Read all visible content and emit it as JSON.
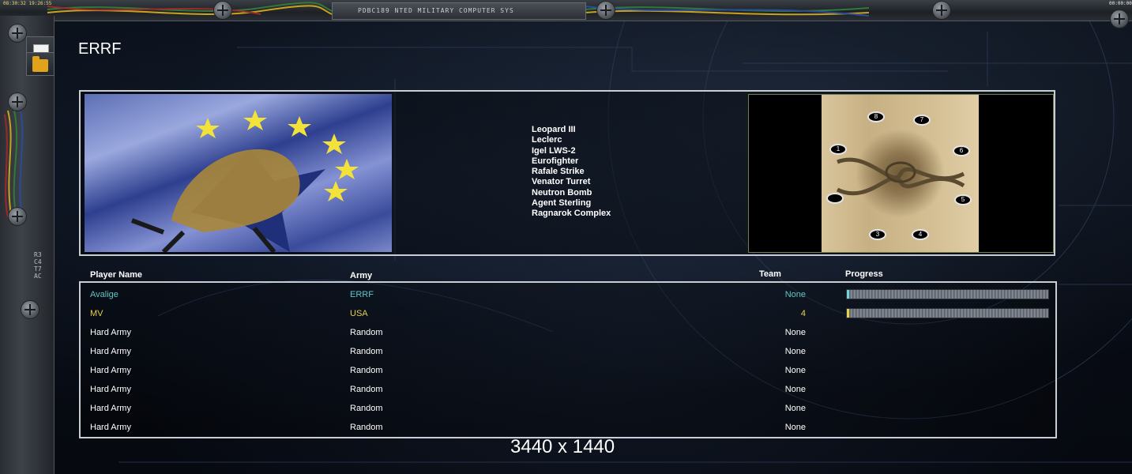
{
  "window": {
    "top_title": "PDBC189 NTED MILITARY COMPUTER SYS",
    "clock_left": "08:30:32 19:26:55",
    "clock_right": "00:00:00",
    "side_code": "R3C4T7AC"
  },
  "page_title": "ERRF",
  "faction": {
    "units": [
      "Leopard III",
      "Leclerc",
      "Igel LWS-2",
      "Eurofighter",
      "Rafale Strike",
      "Venator Turret",
      "Neutron Bomb",
      "Agent Sterling",
      "Ragnarok Complex"
    ]
  },
  "map": {
    "start_positions": [
      "8",
      "7",
      "1",
      "6",
      "",
      "5",
      "3",
      "4"
    ]
  },
  "table": {
    "headers": {
      "player": "Player Name",
      "army": "Army",
      "team": "Team",
      "progress": "Progress"
    },
    "rows": [
      {
        "player": "Avalige",
        "army": "ERRF",
        "team": "None",
        "color": "#5fc6c6",
        "progress": 0.01,
        "progress_color": "#6fd4e0"
      },
      {
        "player": "MV",
        "army": "USA",
        "team": "4",
        "color": "#e7d14a",
        "progress": 0.005,
        "progress_color": "#e7d14a"
      },
      {
        "player": "Hard Army",
        "army": "Random",
        "team": "None",
        "color": "#ffffff"
      },
      {
        "player": "Hard Army",
        "army": "Random",
        "team": "None",
        "color": "#ffffff"
      },
      {
        "player": "Hard Army",
        "army": "Random",
        "team": "None",
        "color": "#ffffff"
      },
      {
        "player": "Hard Army",
        "army": "Random",
        "team": "None",
        "color": "#ffffff"
      },
      {
        "player": "Hard Army",
        "army": "Random",
        "team": "None",
        "color": "#ffffff"
      },
      {
        "player": "Hard Army",
        "army": "Random",
        "team": "None",
        "color": "#ffffff"
      }
    ]
  },
  "resolution_label": "3440 x 1440",
  "colors": {
    "accent_cyan": "#5fc6c6",
    "accent_yellow": "#e7d14a",
    "frame": "#c9ced4"
  }
}
